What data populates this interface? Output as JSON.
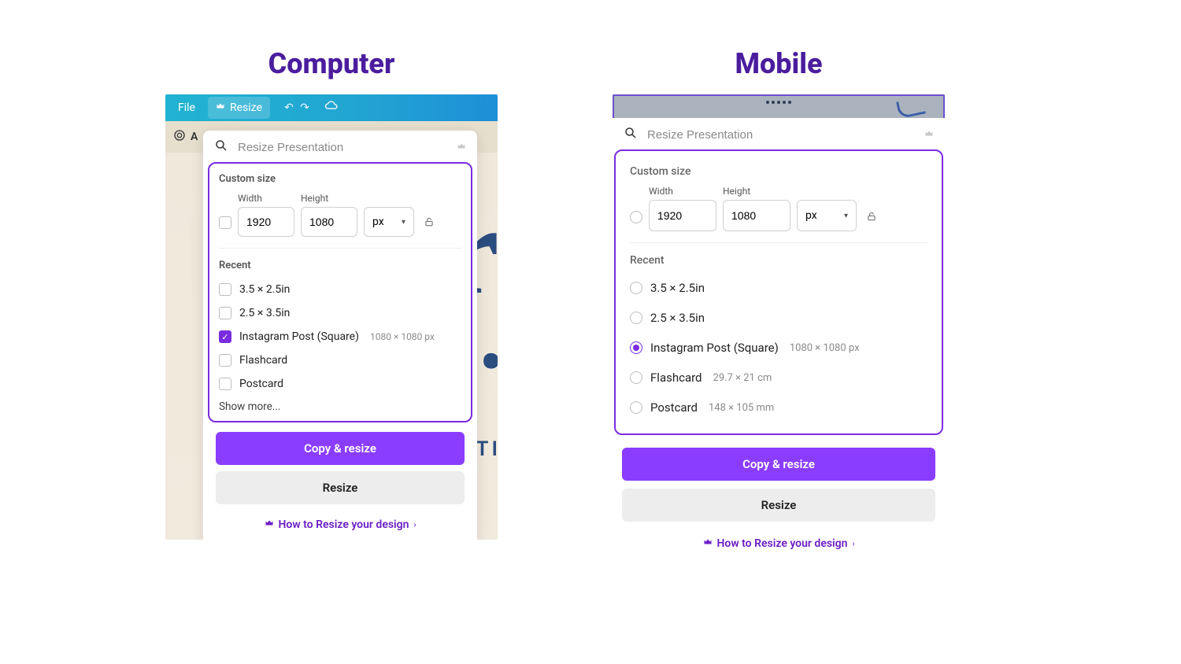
{
  "headings": {
    "computer": "Computer",
    "mobile": "Mobile"
  },
  "topbar": {
    "file": "File",
    "resize": "Resize"
  },
  "search": {
    "placeholder": "Resize Presentation"
  },
  "custom": {
    "heading": "Custom size",
    "width_label": "Width",
    "height_label": "Height",
    "width_value": "1920",
    "height_value": "1080",
    "unit": "px"
  },
  "recent_heading": "Recent",
  "computer_recent": [
    {
      "label": "3.5 × 2.5in",
      "sub": "",
      "selected": false
    },
    {
      "label": "2.5 × 3.5in",
      "sub": "",
      "selected": false
    },
    {
      "label": "Instagram Post (Square)",
      "sub": "1080 × 1080 px",
      "selected": true
    },
    {
      "label": "Flashcard",
      "sub": "",
      "selected": false
    },
    {
      "label": "Postcard",
      "sub": "",
      "selected": false
    }
  ],
  "mobile_recent": [
    {
      "label": "3.5 × 2.5in",
      "sub": "",
      "selected": false
    },
    {
      "label": "2.5 × 3.5in",
      "sub": "",
      "selected": false
    },
    {
      "label": "Instagram Post (Square)",
      "sub": "1080 × 1080 px",
      "selected": true
    },
    {
      "label": "Flashcard",
      "sub": "29.7 × 21 cm",
      "selected": false
    },
    {
      "label": "Postcard",
      "sub": "148 × 105 mm",
      "selected": false
    }
  ],
  "show_more": "Show more...",
  "actions": {
    "copy_resize": "Copy & resize",
    "resize": "Resize",
    "how_link": "How to Resize your design"
  },
  "bg_text": {
    "r": "r",
    "atl": "ATI"
  }
}
